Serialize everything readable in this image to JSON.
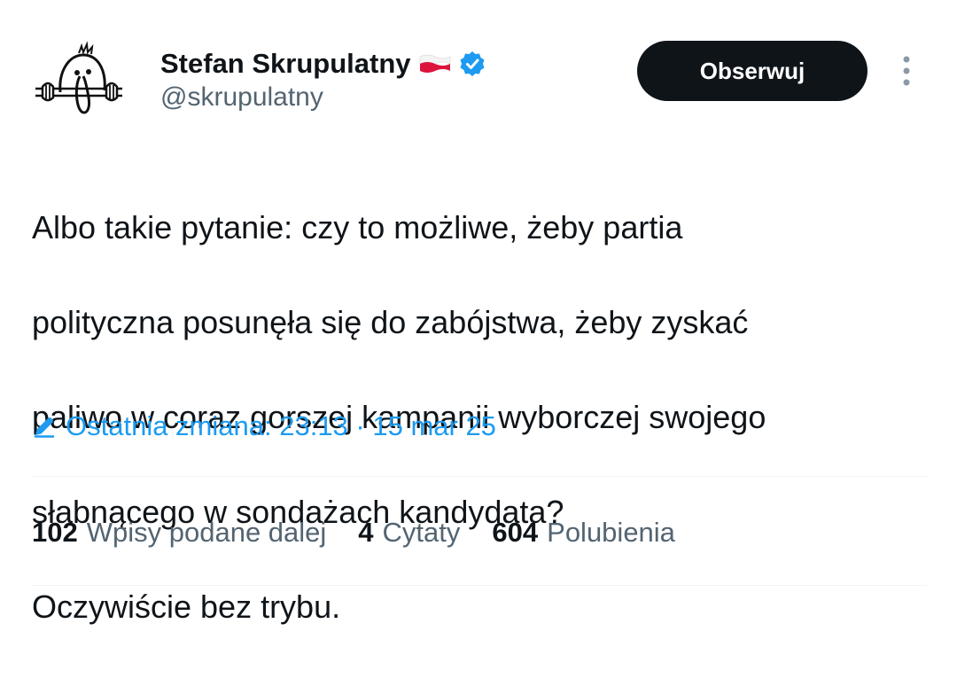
{
  "author": {
    "display_name": "Stefan Skrupulatny",
    "handle": "@skrupulatny",
    "flag": "poland-flag",
    "verified": true,
    "verified_color": "#1d9bf0"
  },
  "follow_button": {
    "label": "Obserwuj",
    "background": "#0f1419",
    "text_color": "#ffffff"
  },
  "tweet": {
    "lines": [
      "Albo takie pytanie: czy to możliwe, żeby partia",
      "polityczna posunęła się do zabójstwa, żeby zyskać",
      "paliwo w coraz gorszej kampanii wyborczej swojego",
      "słabnącego w sondażach kandydata?",
      "Oczywiście bez trybu."
    ]
  },
  "edited": {
    "label": "Ostatnia zmiana: 23:13 · 15 mar 25",
    "icon": "pencil-icon",
    "color": "#1d9bf0"
  },
  "stats": [
    {
      "count": "102",
      "label": "Wpisy podane dalej"
    },
    {
      "count": "4",
      "label": "Cytaty"
    },
    {
      "count": "604",
      "label": "Polubienia"
    }
  ]
}
